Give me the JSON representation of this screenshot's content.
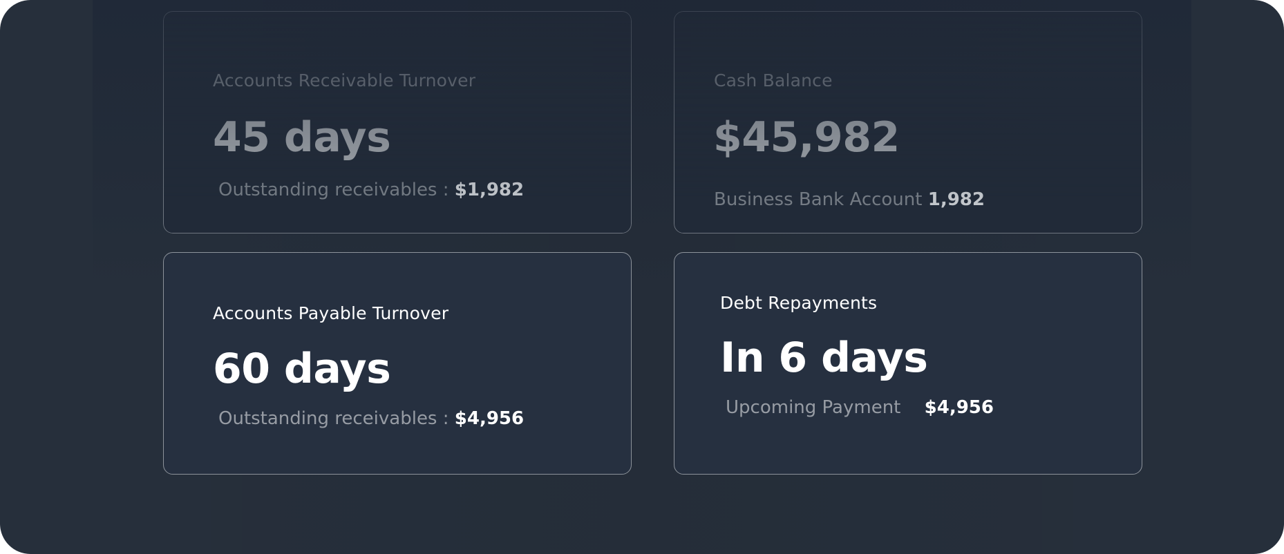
{
  "cards": {
    "ar": {
      "title": "Accounts Receivable Turnover",
      "value": "45 days",
      "sub_label": "Outstanding receivables :",
      "sub_amount": "$1,982"
    },
    "cash": {
      "title": "Cash Balance",
      "value": "$45,982",
      "sub_label": "Business Bank Account",
      "sub_amount": "1,982"
    },
    "ap": {
      "title": "Accounts Payable Turnover",
      "value": "60 days",
      "sub_label": "Outstanding receivables :",
      "sub_amount": "$4,956"
    },
    "debt": {
      "title": "Debt Repayments",
      "value": "In 6 days",
      "sub_label": "Upcoming Payment",
      "sub_amount": "$4,956"
    }
  },
  "colors": {
    "background": "#262f3b",
    "card_border": "#8d939b",
    "text_primary": "#ffffff",
    "text_secondary": "#979ca4"
  }
}
